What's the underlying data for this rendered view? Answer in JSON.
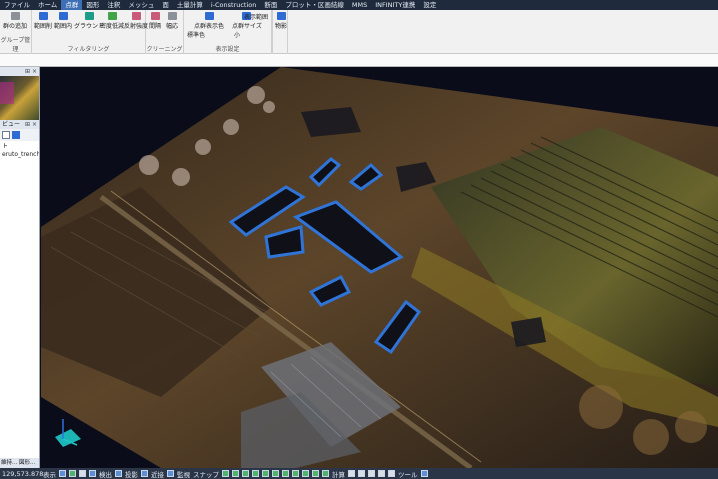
{
  "menu": {
    "items": [
      "ファイル",
      "ホーム",
      "点群",
      "図形",
      "注釈",
      "メッシュ",
      "面",
      "土量計算",
      "i-Construction",
      "断面",
      "プロット・区画結線",
      "MMS",
      "INFINITY連携",
      "設定"
    ],
    "active_index": 2
  },
  "ribbon": {
    "g1_btn": "群の追加",
    "g1_label": "グループ管理",
    "g2_btns": [
      "範囲削",
      "範囲内",
      "グラウンド",
      "密度低減",
      "反射強度"
    ],
    "g2_label": "フィルタリング",
    "g3_btns": [
      "間隔",
      "幅応"
    ],
    "g3_label": "クリーニング",
    "g4_small": [
      "点群表示色",
      "点群サイズ",
      "標準色",
      "小"
    ],
    "g4_label": "表示設定",
    "g5_btn": "表示範囲",
    "g6_btn": "物影"
  },
  "left": {
    "panel1_title": "",
    "panel2_title": "ビュー",
    "tree_root": "ト",
    "tree_file": "eruto_trench.l",
    "bottom_tabs": "維持...  図形..."
  },
  "status": {
    "coord": "129,573.878",
    "labels": [
      "表示",
      "検出",
      "投影",
      "近接",
      "監視",
      "スナップ",
      "計算",
      "ツール"
    ]
  }
}
